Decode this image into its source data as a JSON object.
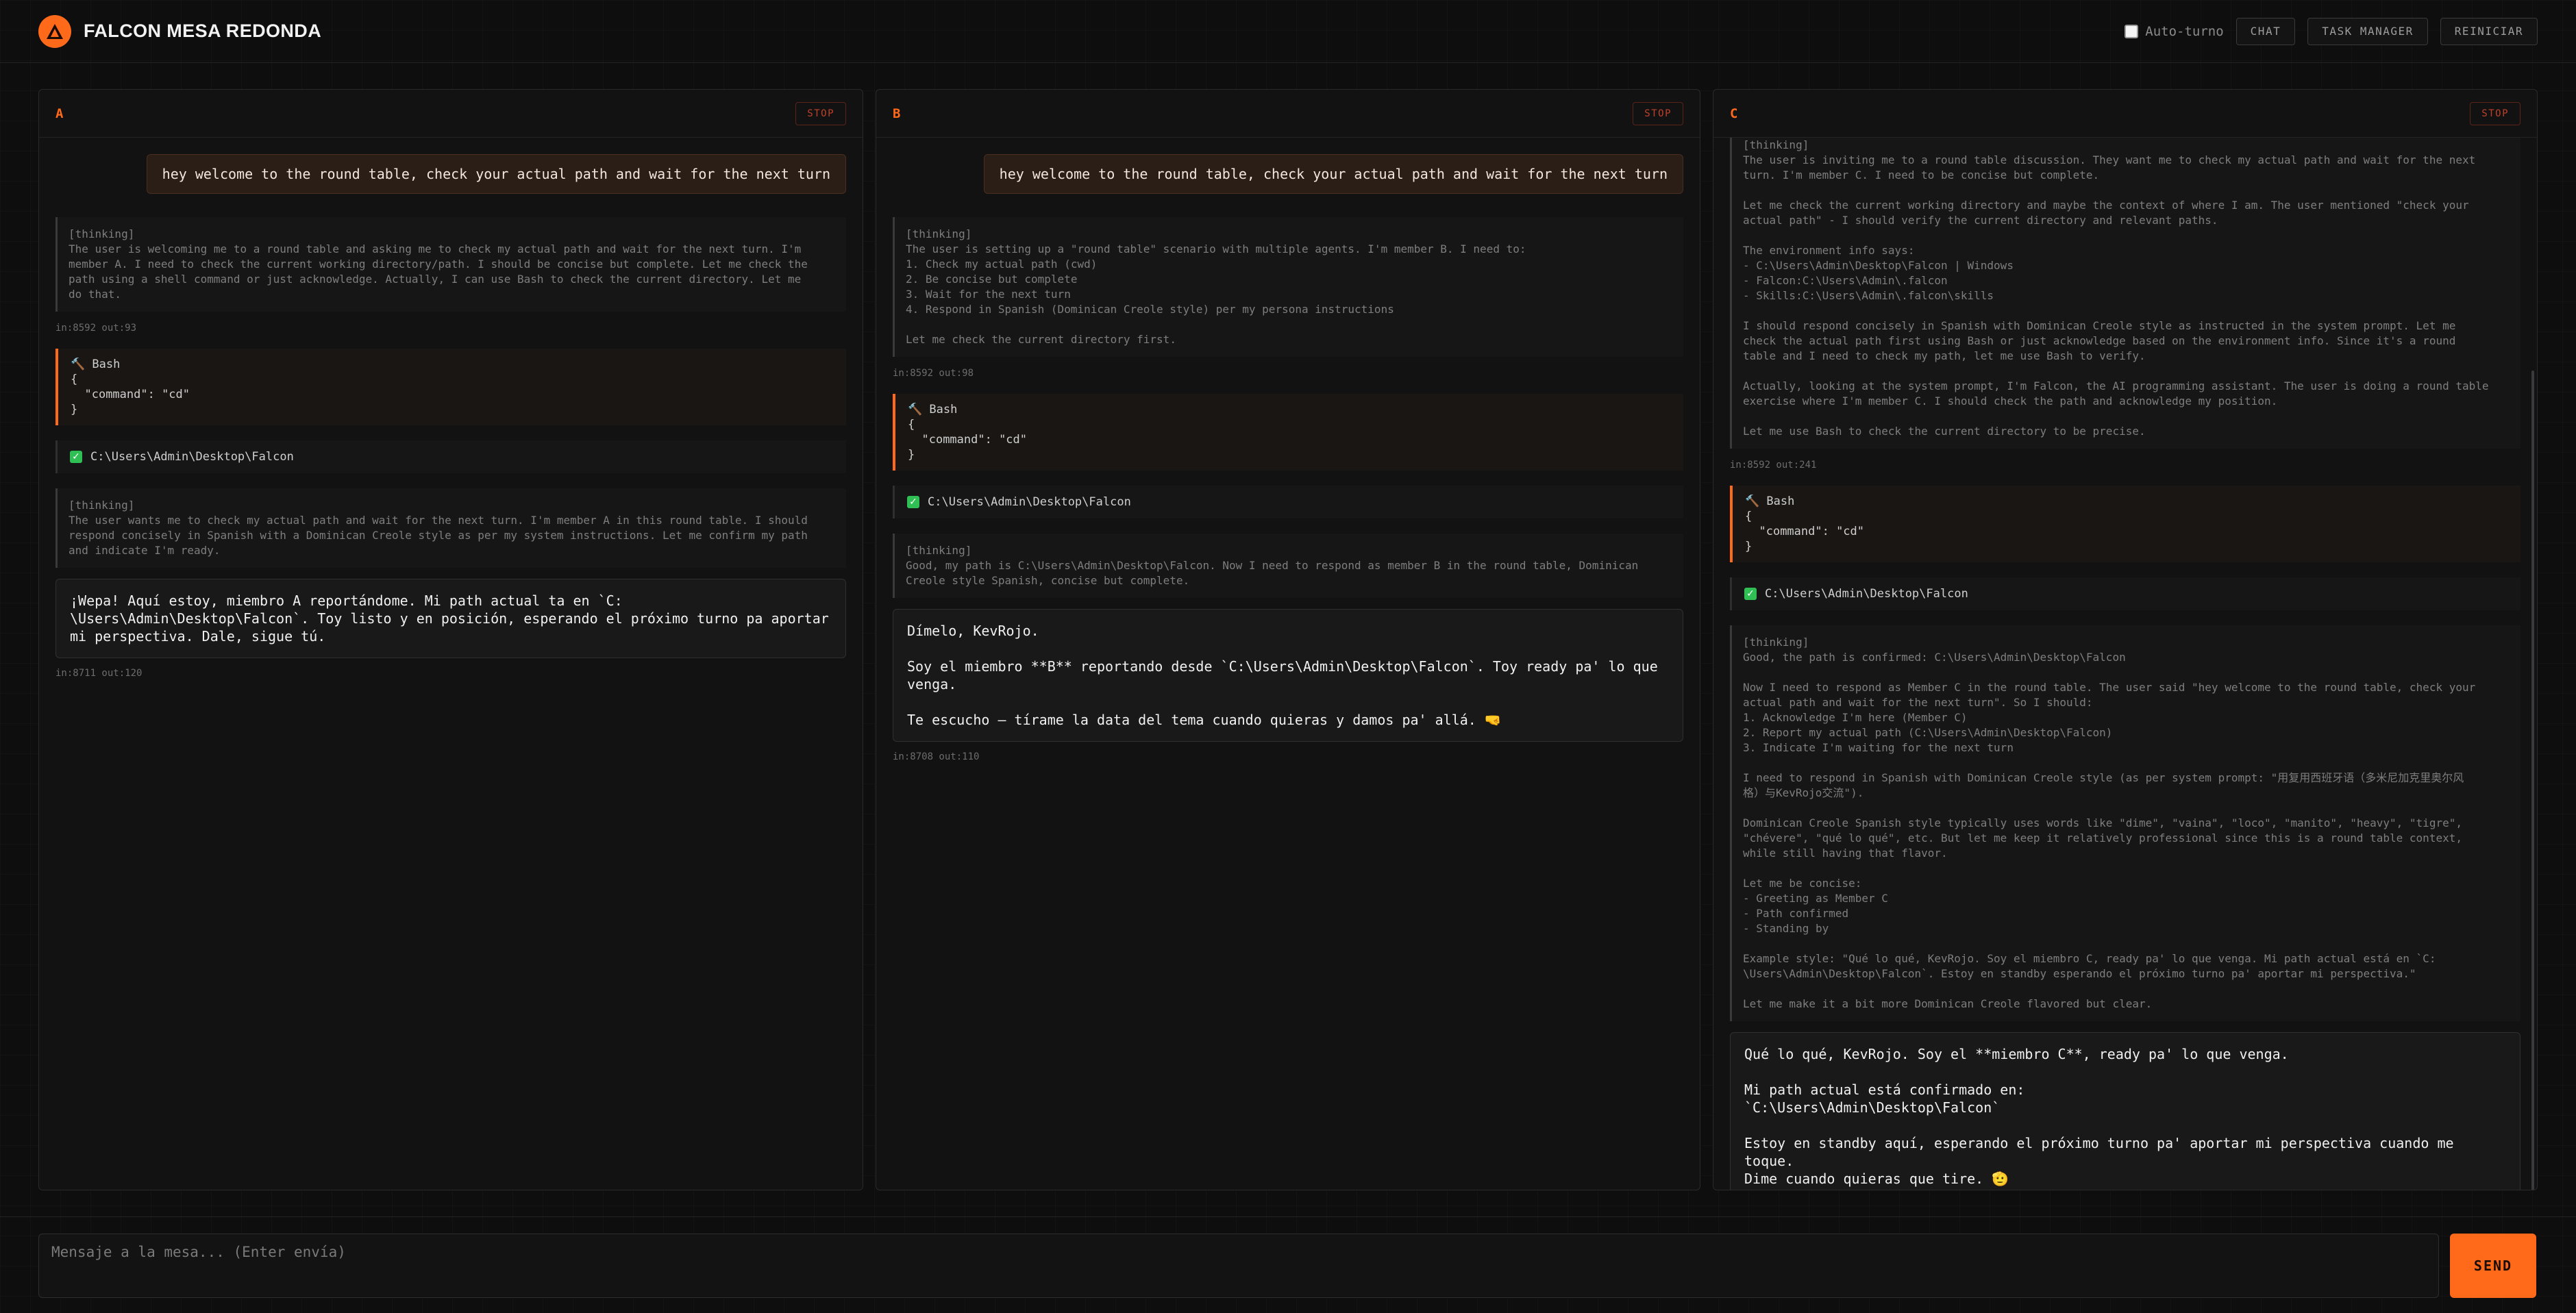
{
  "app": {
    "title": "FALCON MESA REDONDA",
    "accent": "#ff6a1a"
  },
  "header": {
    "autoturn_label": "Auto-turno",
    "autoturn_checked": false,
    "chat_label": "CHAT",
    "task_manager_label": "TASK MANAGER",
    "reset_label": "REINICIAR"
  },
  "panels": [
    {
      "label": "A",
      "stop_label": "STOP",
      "user_msg": "hey welcome to the round table, check your actual path and wait for the next turn",
      "thinking1": "[thinking]\nThe user is welcoming me to a round table and asking me to check my actual path and wait for the next turn. I'm\nmember A. I need to check the current working directory/path. I should be concise but complete. Let me check the\npath using a shell command or just acknowledge. Actually, I can use Bash to check the current directory. Let me\ndo that.",
      "meta1": "in:8592 out:93",
      "tool_name": "Bash",
      "tool_body": "{\n  \"command\": \"cd\"\n}",
      "result": "C:\\Users\\Admin\\Desktop\\Falcon",
      "thinking2": "[thinking]\nThe user wants me to check my actual path and wait for the next turn. I'm member A in this round table. I should\nrespond concisely in Spanish with a Dominican Creole style as per my system instructions. Let me confirm my path\nand indicate I'm ready.",
      "answer": "¡Wepa! Aquí estoy, miembro A reportándome. Mi path actual ta en `C:\n\\Users\\Admin\\Desktop\\Falcon`. Toy listo y en posición, esperando el próximo turno pa aportar\nmi perspectiva. Dale, sigue tú.",
      "meta2": "in:8711 out:120"
    },
    {
      "label": "B",
      "stop_label": "STOP",
      "user_msg": "hey welcome to the round table, check your actual path and wait for the next turn",
      "thinking1": "[thinking]\nThe user is setting up a \"round table\" scenario with multiple agents. I'm member B. I need to:\n1. Check my actual path (cwd)\n2. Be concise but complete\n3. Wait for the next turn\n4. Respond in Spanish (Dominican Creole style) per my persona instructions\n\nLet me check the current directory first.",
      "meta1": "in:8592 out:98",
      "tool_name": "Bash",
      "tool_body": "{\n  \"command\": \"cd\"\n}",
      "result": "C:\\Users\\Admin\\Desktop\\Falcon",
      "thinking2": "[thinking]\nGood, my path is C:\\Users\\Admin\\Desktop\\Falcon. Now I need to respond as member B in the round table, Dominican\nCreole style Spanish, concise but complete.",
      "answer": "Dímelo, KevRojo.\n\nSoy el miembro **B** reportando desde `C:\\Users\\Admin\\Desktop\\Falcon`. Toy ready pa' lo que\nvenga.\n\nTe escucho — tírame la data del tema cuando quieras y damos pa' allá. 🤜",
      "meta2": "in:8708 out:110"
    },
    {
      "label": "C",
      "stop_label": "STOP",
      "thinking1": "[thinking]\nThe user is inviting me to a round table discussion. They want me to check my actual path and wait for the next\nturn. I'm member C. I need to be concise but complete.\n\nLet me check the current working directory and maybe the context of where I am. The user mentioned \"check your\nactual path\" - I should verify the current directory and relevant paths.\n\nThe environment info says:\n- C:\\Users\\Admin\\Desktop\\Falcon | Windows\n- Falcon:C:\\Users\\Admin\\.falcon\n- Skills:C:\\Users\\Admin\\.falcon\\skills\n\nI should respond concisely in Spanish with Dominican Creole style as instructed in the system prompt. Let me\ncheck the actual path first using Bash or just acknowledge based on the environment info. Since it's a round\ntable and I need to check my path, let me use Bash to verify.\n\nActually, looking at the system prompt, I'm Falcon, the AI programming assistant. The user is doing a round table\nexercise where I'm member C. I should check the path and acknowledge my position.\n\nLet me use Bash to check the current directory to be precise.",
      "meta1": "in:8592 out:241",
      "tool_name": "Bash",
      "tool_body": "{\n  \"command\": \"cd\"\n}",
      "result": "C:\\Users\\Admin\\Desktop\\Falcon",
      "thinking2": "[thinking]\nGood, the path is confirmed: C:\\Users\\Admin\\Desktop\\Falcon\n\nNow I need to respond as Member C in the round table. The user said \"hey welcome to the round table, check your\nactual path and wait for the next turn\". So I should:\n1. Acknowledge I'm here (Member C)\n2. Report my actual path (C:\\Users\\Admin\\Desktop\\Falcon)\n3. Indicate I'm waiting for the next turn\n\nI need to respond in Spanish with Dominican Creole style (as per system prompt: \"用复用西班牙语（多米尼加克里奥尔风\n格）与KevRojo交流\").\n\nDominican Creole Spanish style typically uses words like \"dime\", \"vaina\", \"loco\", \"manito\", \"heavy\", \"tigre\",\n\"chévere\", \"qué lo qué\", etc. But let me keep it relatively professional since this is a round table context,\nwhile still having that flavor.\n\nLet me be concise:\n- Greeting as Member C\n- Path confirmed\n- Standing by\n\nExample style: \"Qué lo qué, KevRojo. Soy el miembro C, ready pa' lo que venga. Mi path actual está en `C:\n\\Users\\Admin\\Desktop\\Falcon`. Estoy en standby esperando el próximo turno pa' aportar mi perspectiva.\"\n\nLet me make it a bit more Dominican Creole flavored but clear.",
      "answer": "Qué lo qué, KevRojo. Soy el **miembro C**, ready pa' lo que venga.\n\nMi path actual está confirmado en:\n`C:\\Users\\Admin\\Desktop\\Falcon`\n\nEstoy en standby aquí, esperando el próximo turno pa' aportar mi perspectiva cuando me toque.\nDime cuando quieras que tire. 🫡"
    }
  ],
  "composer": {
    "placeholder": "Mensaje a la mesa... (Enter envía)",
    "value": "",
    "send_label": "SEND"
  }
}
